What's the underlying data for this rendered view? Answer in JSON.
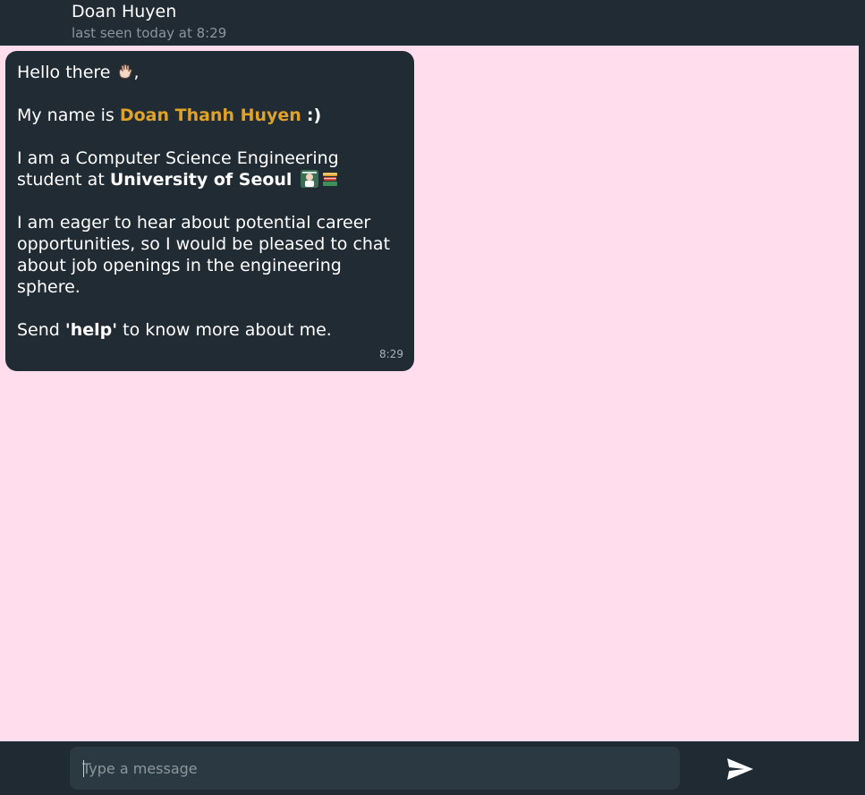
{
  "header": {
    "contact_name": "Doan Huyen",
    "status": "last seen today at 8:29"
  },
  "message": {
    "greeting": "Hello there",
    "greeting_punct": ",",
    "name_prefix": "My name is ",
    "name": "Doan Thanh Huyen",
    "name_suffix": ":)",
    "study_prefix": "I am a Computer Science Engineering student at ",
    "university": "University of Seoul",
    "career_text": "I am eager to hear about potential career opportunities, so I would be pleased to chat about job openings in the engineering sphere.",
    "send_prefix": "Send ",
    "help_keyword": "'help'",
    "send_suffix": " to know more about me.",
    "time": "8:29",
    "emojis": [
      "waving-hand-emoji",
      "student-emoji",
      "books-emoji"
    ]
  },
  "composer": {
    "placeholder": "Type a message",
    "send_icon": "send-icon"
  },
  "colors": {
    "chat_background": "#ffdded",
    "bubble_background": "#212b33",
    "name_highlight": "#e0a32a",
    "header_background": "#212b33"
  }
}
